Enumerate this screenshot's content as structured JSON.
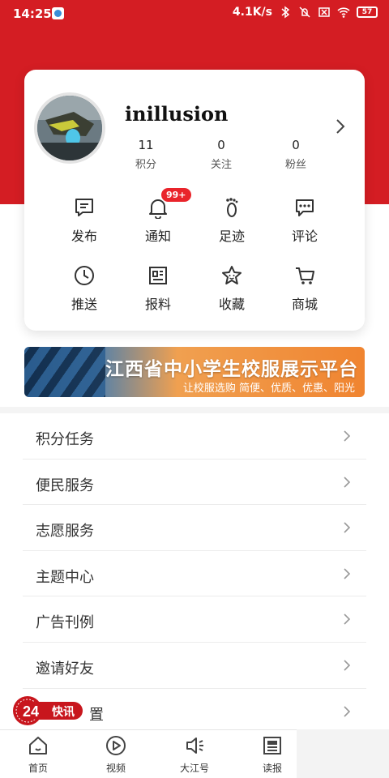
{
  "status_bar": {
    "time": "14:25",
    "net_speed": "4.1K/s",
    "battery": "57"
  },
  "profile": {
    "username": "inillusion",
    "stats": [
      {
        "value": "11",
        "label": "积分"
      },
      {
        "value": "0",
        "label": "关注"
      },
      {
        "value": "0",
        "label": "粉丝"
      }
    ]
  },
  "actions": [
    {
      "label": "发布",
      "icon": "compose-icon"
    },
    {
      "label": "通知",
      "icon": "bell-icon",
      "badge": "99+"
    },
    {
      "label": "足迹",
      "icon": "footprint-icon"
    },
    {
      "label": "评论",
      "icon": "comment-icon"
    },
    {
      "label": "推送",
      "icon": "clock-icon"
    },
    {
      "label": "报料",
      "icon": "newspaper-icon"
    },
    {
      "label": "收藏",
      "icon": "star-icon"
    },
    {
      "label": "商城",
      "icon": "cart-icon"
    }
  ],
  "banner": {
    "title": "江西省中小学生校服展示平台",
    "subtitle": "让校服选购 简便、优质、优惠、阳光"
  },
  "menu": [
    {
      "label": "积分任务"
    },
    {
      "label": "便民服务"
    },
    {
      "label": "志愿服务"
    },
    {
      "label": "主题中心"
    },
    {
      "label": "广告刊例"
    },
    {
      "label": "邀请好友"
    },
    {
      "label": "置"
    }
  ],
  "floating_tag": {
    "num": "24",
    "label": "快讯"
  },
  "bottom_nav": [
    {
      "label": "首页",
      "icon": "home-icon"
    },
    {
      "label": "视频",
      "icon": "play-icon"
    },
    {
      "label": "大江号",
      "icon": "megaphone-icon"
    },
    {
      "label": "读报",
      "icon": "newspaper-icon"
    }
  ],
  "colors": {
    "brand_red": "#d41d23",
    "badge_red": "#e9242b"
  }
}
